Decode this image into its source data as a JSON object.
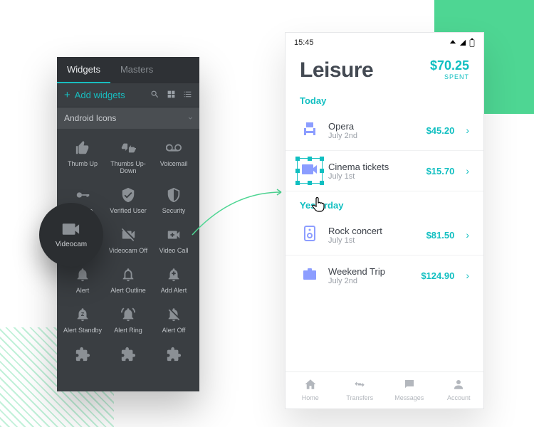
{
  "widgets": {
    "tabs": [
      "Widgets",
      "Masters"
    ],
    "add_label": "Add widgets",
    "section": "Android Icons",
    "icons": [
      {
        "name": "thumb-up-icon",
        "label": "Thumb Up"
      },
      {
        "name": "thumbs-up-down-icon",
        "label": "Thumbs Up-Down"
      },
      {
        "name": "voicemail-icon",
        "label": "Voicemail"
      },
      {
        "name": "secure-icon",
        "label": "Secure"
      },
      {
        "name": "verified-user-icon",
        "label": "Verified User"
      },
      {
        "name": "security-icon",
        "label": "Security"
      },
      {
        "name": "videocam-icon",
        "label": "Videocam"
      },
      {
        "name": "videocam-off-icon",
        "label": "Videocam Off"
      },
      {
        "name": "video-call-icon",
        "label": "Video Call"
      },
      {
        "name": "alert-icon",
        "label": "Alert"
      },
      {
        "name": "alert-outline-icon",
        "label": "Alert Outline"
      },
      {
        "name": "add-alert-icon",
        "label": "Add Alert"
      },
      {
        "name": "alert-standby-icon",
        "label": "Alert Standby"
      },
      {
        "name": "alert-ring-icon",
        "label": "Alert Ring"
      },
      {
        "name": "alert-off-icon",
        "label": "Alert Off"
      },
      {
        "name": "puzzle-icon",
        "label": ""
      },
      {
        "name": "puzzle-icon",
        "label": ""
      },
      {
        "name": "puzzle-icon",
        "label": ""
      }
    ]
  },
  "bubble": {
    "label": "Videocam"
  },
  "phone": {
    "time": "15:45",
    "title": "Leisure",
    "spent": {
      "amount": "$70.25",
      "label": "SPENT"
    },
    "groups": [
      {
        "label": "Today",
        "tx": [
          {
            "icon": "chair-icon",
            "name": "Opera",
            "date": "July 2nd",
            "amount": "$45.20",
            "selected": false
          },
          {
            "icon": "videocam-icon",
            "name": "Cinema tickets",
            "date": "July 1st",
            "amount": "$15.70",
            "selected": true
          }
        ]
      },
      {
        "label": "Yesterday",
        "tx": [
          {
            "icon": "speaker-icon",
            "name": "Rock concert",
            "date": "July 1st",
            "amount": "$81.50",
            "selected": false
          },
          {
            "icon": "briefcase-icon",
            "name": "Weekend Trip",
            "date": "July 2nd",
            "amount": "$124.90",
            "selected": false
          }
        ]
      }
    ],
    "nav": [
      {
        "icon": "home-icon",
        "label": "Home"
      },
      {
        "icon": "transfers-icon",
        "label": "Transfers"
      },
      {
        "icon": "messages-icon",
        "label": "Messages"
      },
      {
        "icon": "account-icon",
        "label": "Account"
      }
    ]
  }
}
